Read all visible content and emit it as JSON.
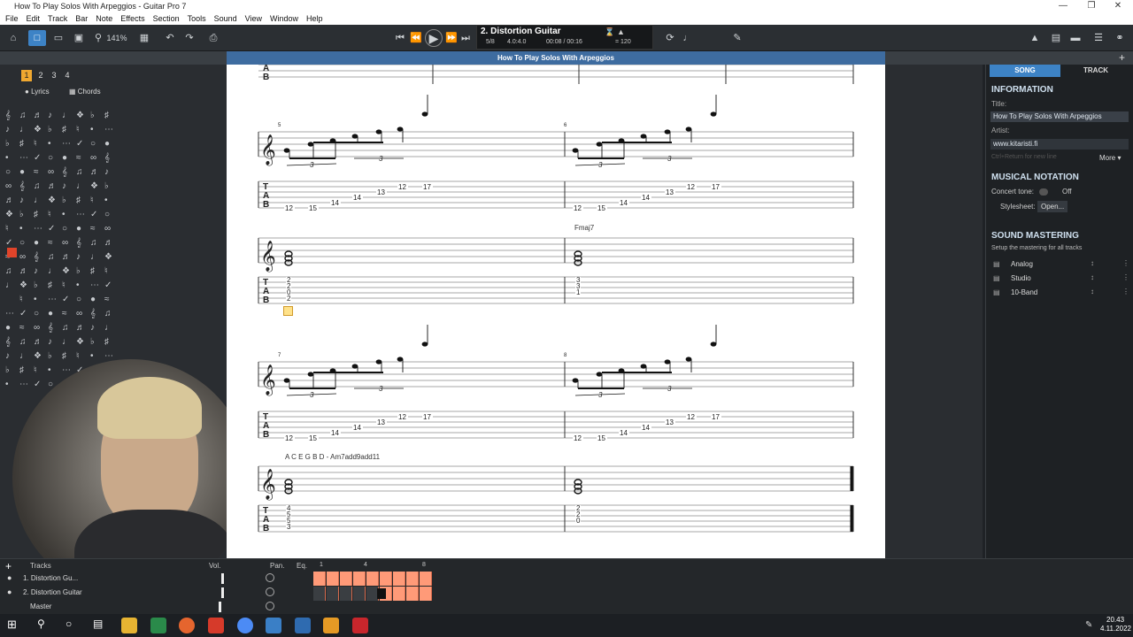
{
  "window": {
    "title": "How To Play Solos With Arpeggios - Guitar Pro 7"
  },
  "menu": [
    "File",
    "Edit",
    "Track",
    "Bar",
    "Note",
    "Effects",
    "Section",
    "Tools",
    "Sound",
    "View",
    "Window",
    "Help"
  ],
  "toolbar": {
    "zoom": "141%",
    "track_name": "2. Distortion Guitar",
    "bar_pos": "5/8",
    "time_sig": "4.0:4.0",
    "time": "00:08 / 00:16",
    "tempo": "= 120"
  },
  "subtitle": "How To Play Solos With Arpeggios",
  "left_panel": {
    "page_buttons": [
      "1",
      "2",
      "3",
      "4"
    ],
    "lyrics": "Lyrics",
    "chords": "Chords"
  },
  "score": {
    "chord1": "Fmaj7",
    "chord2": "A C E G B D - Am7add9add11",
    "tab_letters": [
      "T",
      "A",
      "B"
    ],
    "triplet": "3",
    "sys1_tab": [
      "12",
      "15",
      "14",
      "14",
      "13",
      "12",
      "17",
      "12",
      "15",
      "14",
      "14",
      "13",
      "12",
      "17"
    ],
    "sys1_chords": [
      "2",
      "2",
      "0",
      "2",
      "3",
      "3",
      "1"
    ],
    "sys2_tab": [
      "12",
      "15",
      "14",
      "14",
      "13",
      "12",
      "17",
      "12",
      "15",
      "14",
      "14",
      "13",
      "12",
      "17"
    ],
    "sys2_chords": [
      "4",
      "5",
      "5",
      "3",
      "2",
      "2",
      "0"
    ],
    "bar_nums": [
      "5",
      "6",
      "7",
      "8"
    ]
  },
  "right_panel": {
    "tabs": [
      "SONG",
      "TRACK"
    ],
    "info_head": "INFORMATION",
    "title_lbl": "Title:",
    "title_val": "How To Play Solos With Arpeggios",
    "artist_lbl": "Artist:",
    "artist_val": "www.kitaristi.fi",
    "hint": "Ctrl+Return for new line",
    "more": "More",
    "notation_head": "MUSICAL NOTATION",
    "concert_tone": "Concert tone:",
    "off": "Off",
    "stylesheet": "Stylesheet:",
    "open": "Open...",
    "mastering_head": "SOUND MASTERING",
    "mastering_sub": "Setup the mastering for all tracks",
    "effects": [
      "Analog",
      "Studio",
      "10-Band"
    ]
  },
  "bottom": {
    "tracks_lbl": "Tracks",
    "vol_lbl": "Vol.",
    "pan_lbl": "Pan.",
    "eq_lbl": "Eq.",
    "ruler": [
      "1",
      "4",
      "8"
    ],
    "track1": "1. Distortion Gu...",
    "track2": "2. Distortion Guitar",
    "master": "Master"
  },
  "tray": {
    "time": "20.43",
    "date": "4.11.2022"
  },
  "colors": {
    "accent": "#3d83c6",
    "grid": "#ff9a78",
    "record": "#e0442a"
  }
}
